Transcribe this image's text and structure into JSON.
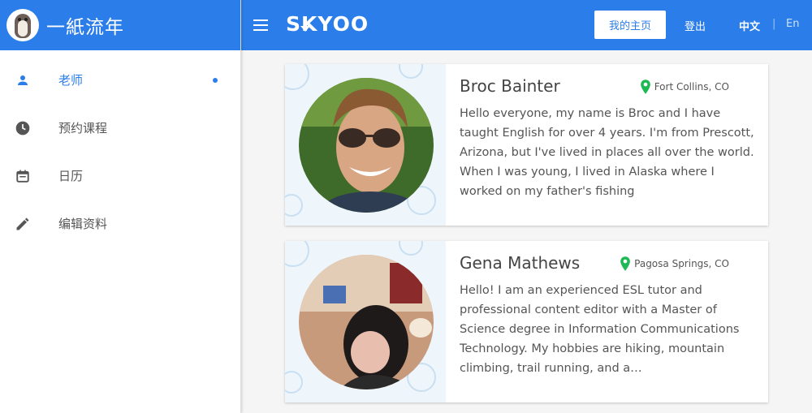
{
  "sidebar": {
    "brand": "一紙流年",
    "items": [
      {
        "label": "老师",
        "icon": "person-icon",
        "active": true
      },
      {
        "label": "预约课程",
        "icon": "clock-icon",
        "active": false
      },
      {
        "label": "日历",
        "icon": "calendar-icon",
        "active": false
      },
      {
        "label": "编辑资料",
        "icon": "pencil-icon",
        "active": false
      }
    ]
  },
  "header": {
    "logo": "SKYOO",
    "home_label": "我的主页",
    "logout_label": "登出",
    "lang_zh": "中文",
    "lang_sep": "|",
    "lang_en": "En"
  },
  "teachers": [
    {
      "name": "Broc Bainter",
      "location": "Fort Collins, CO",
      "bio": "Hello everyone, my name is Broc and I have taught English for over 4 years. I'm from Prescott, Arizona, but I've lived in places all over the world. When I was young, I lived in Alaska where I worked on my father's fishing"
    },
    {
      "name": "Gena Mathews",
      "location": "Pagosa Springs, CO",
      "bio": "Hello! I am an experienced ESL tutor and professional content editor with a Master of Science degree in Information Communications Technology. My hobbies are hiking, mountain climbing, trail running, and a…"
    }
  ],
  "colors": {
    "primary": "#2b7de9",
    "pin": "#1db954"
  }
}
